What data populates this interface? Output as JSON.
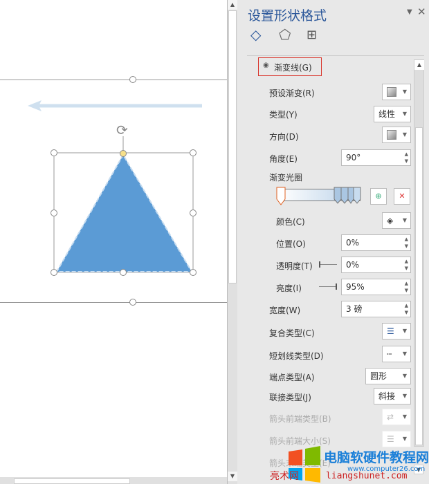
{
  "panel": {
    "title": "设置形状格式",
    "tabs": [
      "fill-line",
      "effects",
      "size-properties"
    ],
    "gradient_line": "渐变线(G)",
    "preset": "预设渐变(R)",
    "type_label": "类型(Y)",
    "type_value": "线性",
    "direction": "方向(D)",
    "angle_label": "角度(E)",
    "angle_value": "90°",
    "stops_label": "渐变光圈",
    "color": "颜色(C)",
    "position_label": "位置(O)",
    "position_value": "0%",
    "transparency_label": "透明度(T)",
    "transparency_value": "0%",
    "brightness_label": "亮度(I)",
    "brightness_value": "95%",
    "width_label": "宽度(W)",
    "width_value": "3 磅",
    "compound": "复合类型(C)",
    "dash": "短划线类型(D)",
    "cap_label": "端点类型(A)",
    "cap_value": "圆形",
    "join_label": "联接类型(J)",
    "join_value": "斜接",
    "arrow_begin_type": "箭头前端类型(B)",
    "arrow_begin_size": "箭头前端大小(S)",
    "arrow_end_type": "箭头末端类型(E)"
  },
  "watermark": {
    "text": "电脑软硬件教程网",
    "url": "www.computer26.com",
    "sub": "liangshunet.com",
    "red": "亮术网"
  },
  "colors": {
    "accent": "#2b579a",
    "shape": "#5b9bd5",
    "highlight": "#d9342b"
  }
}
